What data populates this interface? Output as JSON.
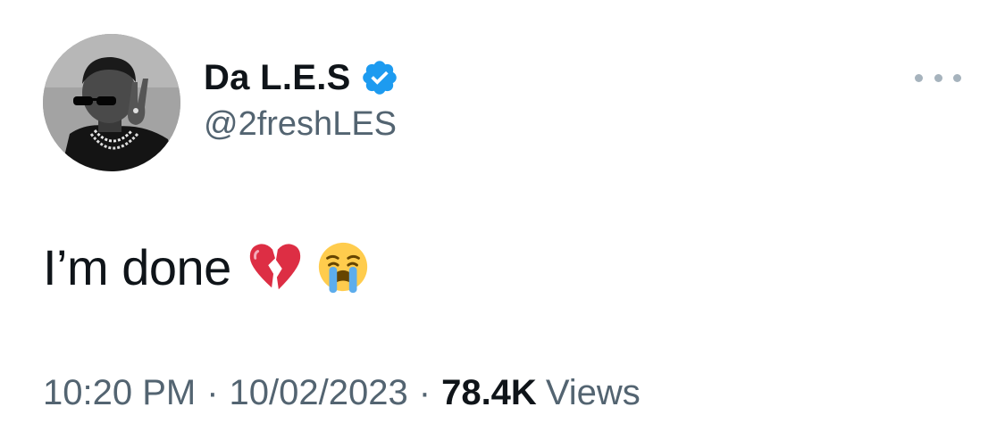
{
  "tweet": {
    "display_name": "Da L.E.S",
    "handle": "@2freshLES",
    "verified": true,
    "text": "I’m done",
    "emojis": [
      "broken-heart-emoji",
      "loudly-crying-face-emoji"
    ],
    "time": "10:20 PM",
    "separator": "·",
    "date": "10/02/2023",
    "view_count": "78.4K",
    "views_label": "Views"
  },
  "icons": {
    "verified": "verified-badge-icon",
    "more": "more-options-icon"
  },
  "colors": {
    "verified_blue": "#1d9bf0",
    "secondary_text": "#536471",
    "primary_text": "#0f1419"
  }
}
